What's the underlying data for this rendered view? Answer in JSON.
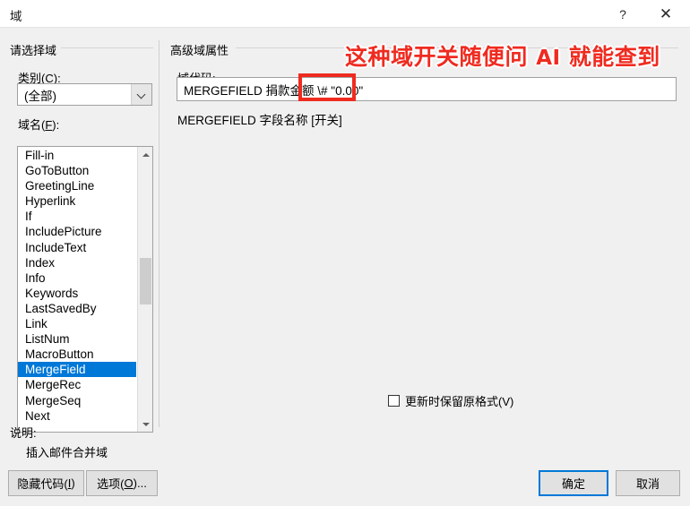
{
  "window": {
    "title": "域",
    "help_icon": "?",
    "close_icon": "✕"
  },
  "left_panel": {
    "group_caption": "请选择域",
    "category_label": "类别(C):",
    "category_value": "(全部)",
    "fieldname_label": "域名(F):",
    "field_items": [
      "Fill-in",
      "GoToButton",
      "GreetingLine",
      "Hyperlink",
      "If",
      "IncludePicture",
      "IncludeText",
      "Index",
      "Info",
      "Keywords",
      "LastSavedBy",
      "Link",
      "ListNum",
      "MacroButton",
      "MergeField",
      "MergeRec",
      "MergeSeq",
      "Next"
    ],
    "selected_item": "MergeField",
    "scroll_up_icon": "chevron-up",
    "scroll_down_icon": "chevron-down"
  },
  "right_panel": {
    "group_caption": "高级域属性",
    "fieldcode_label": "域代码:",
    "fieldcode_value": "MERGEFIELD  捐款金额 \\# \"0.00\"",
    "syntax_hint": "MERGEFIELD 字段名称 [开关]",
    "preserve_format_label": "更新时保留原格式(V)",
    "preserve_format_checked": false
  },
  "description": {
    "label": "说明:",
    "text": "插入邮件合并域"
  },
  "footer": {
    "hide_codes_button": "隐藏代码(I)",
    "options_button": "选项(O)...",
    "ok_button": "确定",
    "cancel_button": "取消"
  },
  "annotation": {
    "text_prefix": "这种域开关随便问 ",
    "text_ai": "AI",
    "text_suffix": " 就能查到",
    "color": "#ef2b20",
    "highlight_target": "\\# \"0.00\""
  }
}
